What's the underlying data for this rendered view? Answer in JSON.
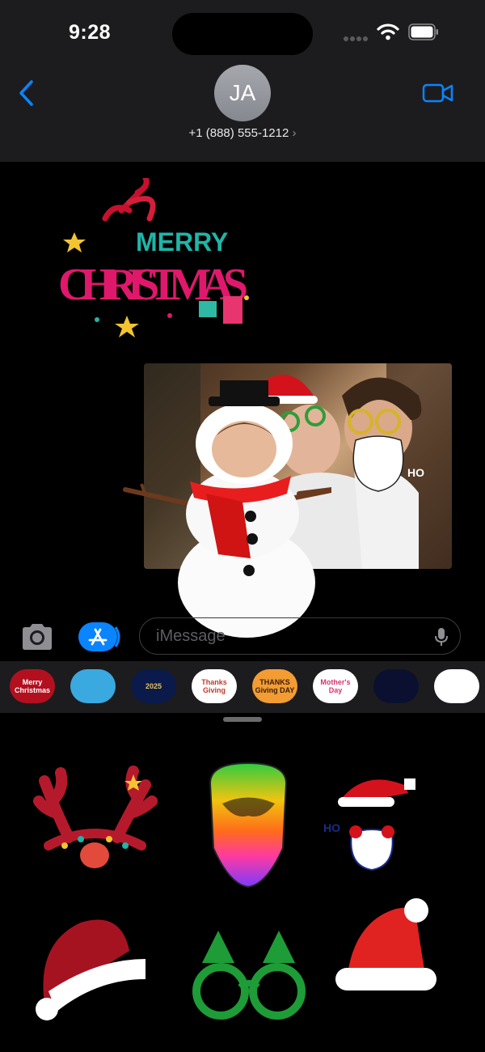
{
  "status_bar": {
    "time": "9:28"
  },
  "contact": {
    "initials": "JA",
    "phone": "+1 (888) 555-1212",
    "phone_chevron": "›"
  },
  "conversation": {
    "sticker_text_line1": "MERRY",
    "sticker_text_line2": "CHRISTMAS",
    "photo_sticker_text": "HO"
  },
  "compose": {
    "placeholder": "iMessage"
  },
  "app_strip": {
    "apps": [
      {
        "name": "merry-christmas-app",
        "label": "Merry Christmas",
        "bg": "#b3101f",
        "fg": "#ffffff"
      },
      {
        "name": "santa-app",
        "label": "",
        "bg": "#3aa9e0",
        "fg": "#ffffff"
      },
      {
        "name": "new-year-2025-app",
        "label": "2025",
        "bg": "#0a1a4a",
        "fg": "#e7c25a"
      },
      {
        "name": "thanksgiving-app",
        "label": "Thanks Giving",
        "bg": "#ffffff",
        "fg": "#c0392b"
      },
      {
        "name": "thanksgiving-day-app",
        "label": "THANKS Giving DAY",
        "bg": "#f39c33",
        "fg": "#3a1d0a"
      },
      {
        "name": "mothers-day-app",
        "label": "Mother's Day",
        "bg": "#ffffff",
        "fg": "#d6336c"
      },
      {
        "name": "fireworks-app",
        "label": "",
        "bg": "#0b1030",
        "fg": "#ffffff"
      },
      {
        "name": "turkey-app",
        "label": "",
        "bg": "#ffffff",
        "fg": "#c25b1f"
      }
    ]
  },
  "drawer": {
    "stickers": [
      "reindeer-antlers-headband",
      "rainbow-beard",
      "santa-hat-beard",
      "glitter-santa-hat",
      "christmas-tree-glasses",
      "red-santa-hat"
    ],
    "santa_hat_beard_text": "HO"
  },
  "colors": {
    "accent": "#0a84ff",
    "header_bg": "#1c1c1e"
  }
}
